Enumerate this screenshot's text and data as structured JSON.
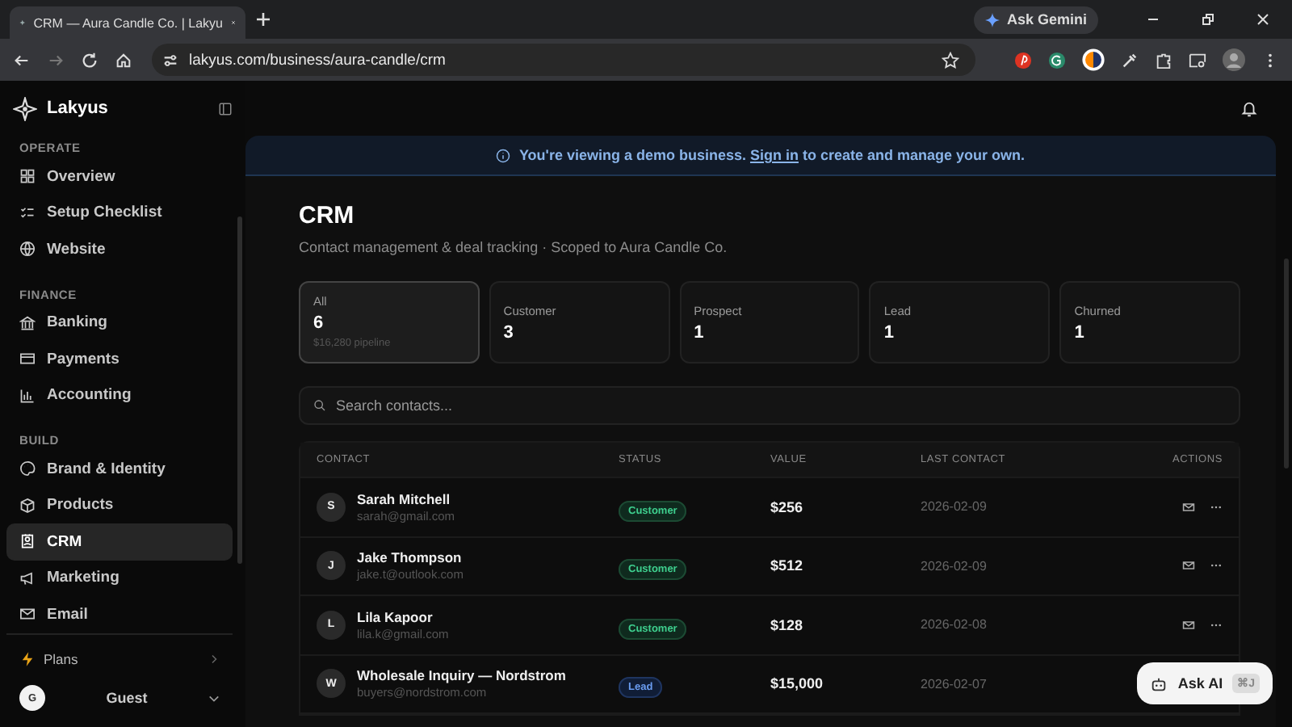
{
  "browser": {
    "tab_title": "CRM — Aura Candle Co. | Lakyu",
    "url": "lakyus.com/business/aura-candle/crm",
    "gemini": "Ask Gemini"
  },
  "sidebar": {
    "brand": "Lakyus",
    "sections": [
      {
        "label": "OPERATE",
        "items": [
          {
            "label": "Overview",
            "selected": false
          },
          {
            "label": "Setup Checklist",
            "selected": false
          },
          {
            "label": "Website",
            "selected": false
          }
        ]
      },
      {
        "label": "FINANCE",
        "items": [
          {
            "label": "Banking",
            "selected": false
          },
          {
            "label": "Payments",
            "selected": false
          },
          {
            "label": "Accounting",
            "selected": false
          }
        ]
      },
      {
        "label": "BUILD",
        "items": [
          {
            "label": "Brand & Identity",
            "selected": false
          },
          {
            "label": "Products",
            "selected": false
          },
          {
            "label": "CRM",
            "selected": true
          },
          {
            "label": "Marketing",
            "selected": false
          },
          {
            "label": "Email",
            "selected": false
          }
        ]
      }
    ],
    "plans": "Plans",
    "user_initial": "G",
    "user": "Guest"
  },
  "banner": {
    "before": "You're viewing a demo business.",
    "link": "Sign in",
    "after": "to create and manage your own."
  },
  "page": {
    "title": "CRM",
    "subtitle": "Contact management & deal tracking · Scoped to Aura Candle Co."
  },
  "stats": [
    {
      "label": "All",
      "value": "6",
      "note": "$16,280 pipeline",
      "selected": true
    },
    {
      "label": "Customer",
      "value": "3",
      "selected": false
    },
    {
      "label": "Prospect",
      "value": "1",
      "selected": false
    },
    {
      "label": "Lead",
      "value": "1",
      "selected": false
    },
    {
      "label": "Churned",
      "value": "1",
      "selected": false
    }
  ],
  "search": {
    "placeholder": "Search contacts..."
  },
  "table": {
    "columns": [
      "CONTACT",
      "STATUS",
      "VALUE",
      "LAST CONTACT",
      "ACTIONS"
    ],
    "rows": [
      {
        "initial": "S",
        "name": "Sarah Mitchell",
        "email": "sarah@gmail.com",
        "status": "Customer",
        "kind": "customer",
        "value": "$256",
        "last_contact": "2026-02-09"
      },
      {
        "initial": "J",
        "name": "Jake Thompson",
        "email": "jake.t@outlook.com",
        "status": "Customer",
        "kind": "customer",
        "value": "$512",
        "last_contact": "2026-02-09"
      },
      {
        "initial": "L",
        "name": "Lila Kapoor",
        "email": "lila.k@gmail.com",
        "status": "Customer",
        "kind": "customer",
        "value": "$128",
        "last_contact": "2026-02-08"
      },
      {
        "initial": "W",
        "name": "Wholesale Inquiry — Nordstrom",
        "email": "buyers@nordstrom.com",
        "status": "Lead",
        "kind": "lead",
        "value": "$15,000",
        "last_contact": "2026-02-07"
      }
    ]
  },
  "ask_ai": {
    "label": "Ask AI",
    "shortcut": "⌘J"
  }
}
